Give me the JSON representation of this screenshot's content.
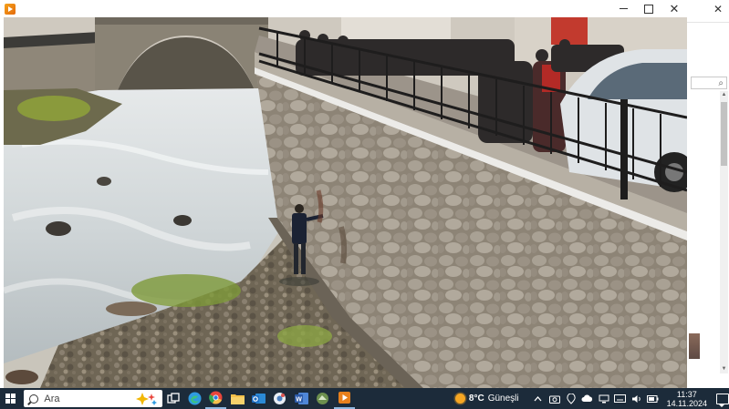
{
  "window": {
    "title": "",
    "minimize_label": "",
    "maximize_label": "",
    "close_label": "✕"
  },
  "background_window": {
    "close_label": "✕",
    "search_glyph": "⌕"
  },
  "video": {
    "description_free": true
  },
  "taskbar": {
    "search_placeholder": "Ara",
    "weather": {
      "temperature": "8°C",
      "condition": "Güneşli"
    },
    "clock": {
      "time": "11:37",
      "date": "14.11.2024"
    },
    "pinned_icons": [
      "task-view-icon",
      "edge-icon",
      "chrome-icon",
      "file-explorer-icon",
      "outlook-icon",
      "network-app-icon",
      "word-icon",
      "remote-app-icon",
      "media-player-icon"
    ],
    "colors": {
      "taskbar_bg": "#1c2b3a",
      "edge": "#2f9be0",
      "chrome": "#e8453c",
      "explorer": "#f4c04a",
      "outlook": "#1f6fc4",
      "word": "#2b5aa8",
      "media": "#e8801c"
    }
  }
}
